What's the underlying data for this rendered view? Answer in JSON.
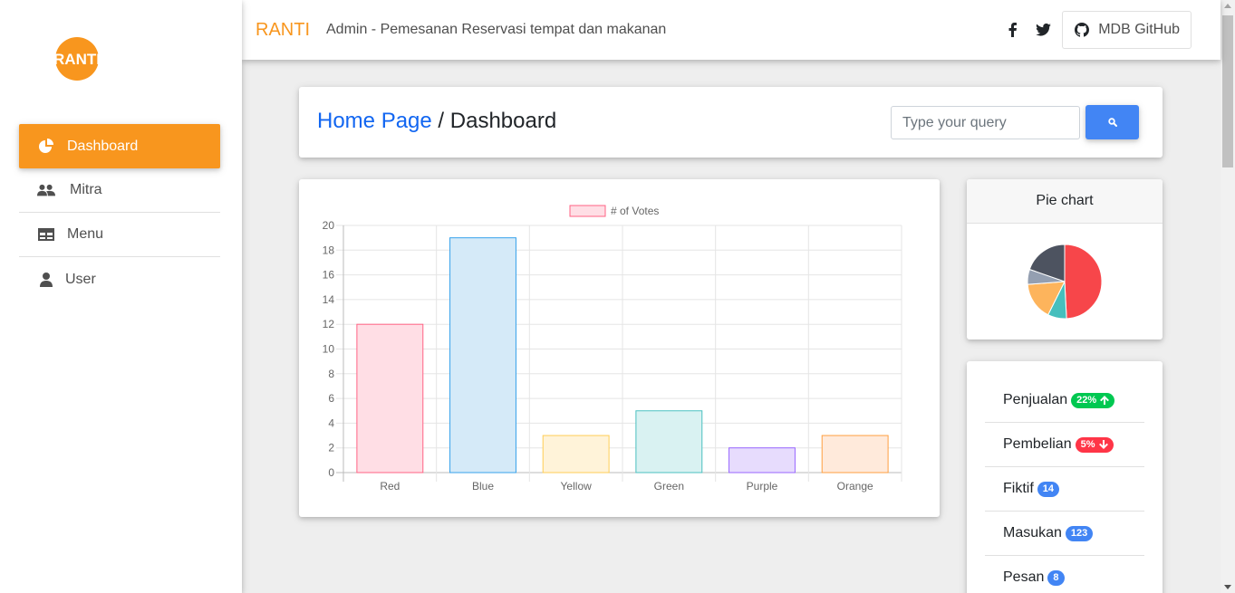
{
  "app": {
    "brand": "RANTI",
    "tagline": "Admin - Pemesanan Reservasi tempat dan makanan",
    "github_label": "MDB GitHub",
    "logo_text": "RANTI"
  },
  "sidebar": {
    "items": [
      {
        "label": "Dashboard",
        "icon": "chart-pie-icon",
        "active": true
      },
      {
        "label": "Mitra",
        "icon": "users-icon"
      },
      {
        "label": "Menu",
        "icon": "table-icon"
      },
      {
        "label": "User",
        "icon": "user-icon"
      }
    ]
  },
  "header": {
    "breadcrumb_link": "Home Page",
    "breadcrumb_sep": " / ",
    "breadcrumb_current": "Dashboard",
    "search_placeholder": "Type your query"
  },
  "chart_data": {
    "type": "bar",
    "categories": [
      "Red",
      "Blue",
      "Yellow",
      "Green",
      "Purple",
      "Orange"
    ],
    "series": [
      {
        "name": "# of Votes",
        "values": [
          12,
          19,
          3,
          5,
          2,
          3
        ]
      }
    ],
    "ylim": [
      0,
      20
    ],
    "yticks": [
      0,
      2,
      4,
      6,
      8,
      10,
      12,
      14,
      16,
      18,
      20
    ],
    "legend": "top",
    "grid": true,
    "fill_colors": [
      "#ffdee5",
      "#d5eaf8",
      "#fff3d9",
      "#d9f2f2",
      "#e7dcfd",
      "#ffeadb"
    ],
    "border_colors": [
      "#ff6384",
      "#36a2eb",
      "#ffce56",
      "#4bc0c0",
      "#9966ff",
      "#ff9f40"
    ]
  },
  "pie": {
    "title": "Pie chart",
    "values": [
      300,
      50,
      100,
      40,
      120
    ],
    "colors": [
      "#f7464a",
      "#46bfbd",
      "#fdb45c",
      "#949fb1",
      "#4d5360"
    ]
  },
  "stats": [
    {
      "label": "Penjualan",
      "badge": "22%",
      "color": "green",
      "arrow": "up"
    },
    {
      "label": "Pembelian",
      "badge": "5%",
      "color": "red",
      "arrow": "down"
    },
    {
      "label": "Fiktif",
      "badge": "14",
      "color": "blue"
    },
    {
      "label": "Masukan",
      "badge": "123",
      "color": "blue"
    },
    {
      "label": "Pesan",
      "badge": "8",
      "color": "blue"
    }
  ]
}
